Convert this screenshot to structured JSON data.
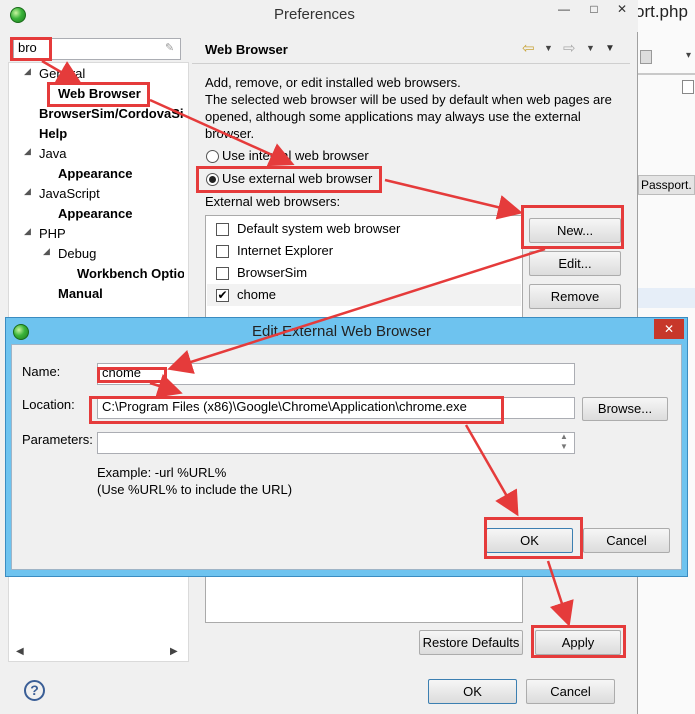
{
  "preferences": {
    "title": "Preferences",
    "filter_value": "bro",
    "tree": [
      {
        "label": "General",
        "bold": false
      },
      {
        "label": "Web Browser",
        "bold": true
      },
      {
        "label": "BrowserSim/CordovaSi",
        "bold": true
      },
      {
        "label": "Help",
        "bold": true
      },
      {
        "label": "Java",
        "bold": false
      },
      {
        "label": "Appearance",
        "bold": true
      },
      {
        "label": "JavaScript",
        "bold": false
      },
      {
        "label": "Appearance",
        "bold": true
      },
      {
        "label": "PHP",
        "bold": false
      },
      {
        "label": "Debug",
        "bold": false
      },
      {
        "label": "Workbench Optio",
        "bold": true
      },
      {
        "label": "Manual",
        "bold": true
      }
    ],
    "page_title": "Web Browser",
    "description_1": "Add, remove, or edit installed web browsers.",
    "description_2": "The selected web browser will be used by default when web pages are opened, although some applications may always use the external browser.",
    "radio_internal": "Use internal web browser",
    "radio_external": "Use external web browser",
    "external_label": "External web browsers:",
    "browsers": [
      {
        "name": "Default system web browser",
        "checked": false
      },
      {
        "name": "Internet Explorer",
        "checked": false
      },
      {
        "name": "BrowserSim",
        "checked": false
      },
      {
        "name": "chome",
        "checked": true
      }
    ],
    "btn_new": "New...",
    "btn_edit": "Edit...",
    "btn_remove": "Remove",
    "btn_restore": "Restore Defaults",
    "btn_apply": "Apply",
    "btn_ok": "OK",
    "btn_cancel": "Cancel",
    "help_symbol": "?"
  },
  "ide": {
    "title_fragment": "ort.php",
    "tab_label": "Passport."
  },
  "dialog": {
    "title": "Edit External Web Browser",
    "name_label": "Name:",
    "name_value": "chome",
    "location_label": "Location:",
    "location_value": "C:\\Program Files (x86)\\Google\\Chrome\\Application\\chrome.exe",
    "browse_button": "Browse...",
    "parameters_label": "Parameters:",
    "parameters_value": "",
    "example_1": "Example: -url %URL%",
    "example_2": "(Use %URL% to include the URL)",
    "ok_button": "OK",
    "cancel_button": "Cancel",
    "close_symbol": "✕"
  },
  "colors": {
    "annotation_red": "#e53b3b",
    "dialog_title_blue": "#6ec3ef",
    "close_red": "#c7372a"
  }
}
